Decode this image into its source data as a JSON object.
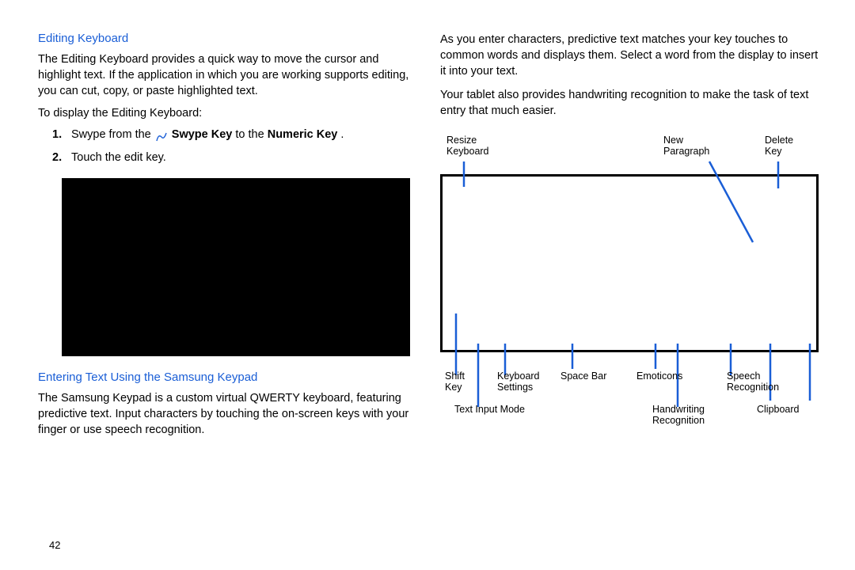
{
  "left": {
    "heading1": "Editing Keyboard",
    "para1": "The Editing Keyboard provides a quick way to move the cursor and highlight text. If the application in which you are working supports editing, you can cut, copy, or paste highlighted text.",
    "lead1": "To display the Editing Keyboard:",
    "step1_num": "1.",
    "step1_a": "Swype from the ",
    "step1_b": "Swype Key",
    "step1_c": " to the ",
    "step1_d": "Numeric Key",
    "step1_e": ".",
    "step2_num": "2.",
    "step2": "Touch the edit key.",
    "heading2": "Entering Text Using the Samsung Keypad",
    "para2": "The Samsung Keypad is a custom virtual QWERTY keyboard, featuring predictive text. Input characters by touching the on-screen keys with your finger or use speech recognition."
  },
  "right": {
    "para1": "As you enter characters, predictive text matches your key touches to common words and displays them. Select a word from the display to insert it into your text.",
    "para2": "Your tablet also provides handwriting recognition to make the task of text entry that much easier."
  },
  "diagram": {
    "resize": "Resize\nKeyboard",
    "newpara": "New\nParagraph",
    "delete": "Delete\nKey",
    "shift": "Shift\nKey",
    "kbdset": "Keyboard\nSettings",
    "spacebar": "Space Bar",
    "emoticons": "Emoticons",
    "speech": "Speech\nRecognition",
    "textinput": "Text Input Mode",
    "handwriting": "Handwriting\nRecognition",
    "clipboard": "Clipboard"
  },
  "page": "42"
}
